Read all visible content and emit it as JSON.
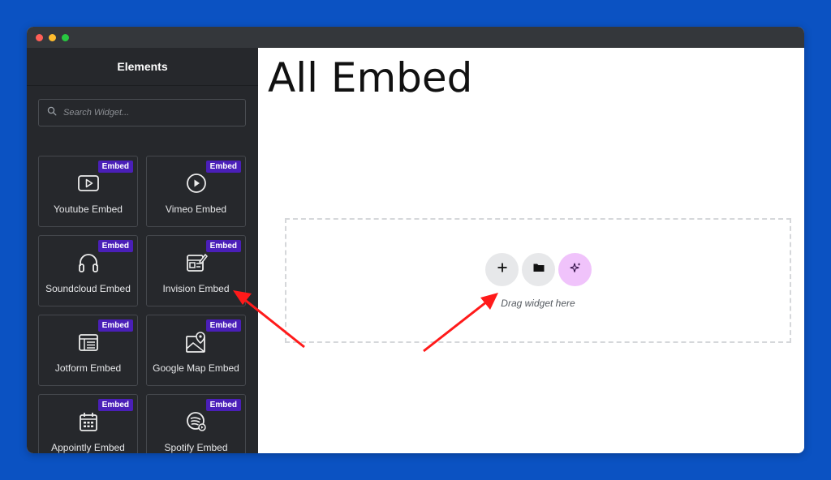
{
  "sidebar": {
    "title": "Elements",
    "search": {
      "placeholder": "Search Widget..."
    },
    "collapse_icon": "chevron-left-icon",
    "widgets": [
      {
        "label": "Youtube Embed",
        "badge": "Embed",
        "icon": "youtube-icon"
      },
      {
        "label": "Vimeo Embed",
        "badge": "Embed",
        "icon": "play-circle-icon"
      },
      {
        "label": "Soundcloud Embed",
        "badge": "Embed",
        "icon": "headphones-icon"
      },
      {
        "label": "Invision Embed",
        "badge": "Embed",
        "icon": "design-board-icon"
      },
      {
        "label": "Jotform Embed",
        "badge": "Embed",
        "icon": "form-icon"
      },
      {
        "label": "Google Map Embed",
        "badge": "Embed",
        "icon": "map-icon"
      },
      {
        "label": "Appointly Embed",
        "badge": "Embed",
        "icon": "calendar-icon"
      },
      {
        "label": "Spotify Embed",
        "badge": "Embed",
        "icon": "spotify-icon"
      }
    ]
  },
  "canvas": {
    "title": "All Embed",
    "dropzone": {
      "text": "Drag widget here",
      "buttons": [
        "plus-icon",
        "folder-icon",
        "ai-sparkle-icon"
      ]
    }
  },
  "colors": {
    "background": "#0b52c2",
    "sidebar": "#26282c",
    "badge": "#4a1fb8",
    "ai_button": "#f0c3fb",
    "arrow": "#ff1a1a"
  }
}
